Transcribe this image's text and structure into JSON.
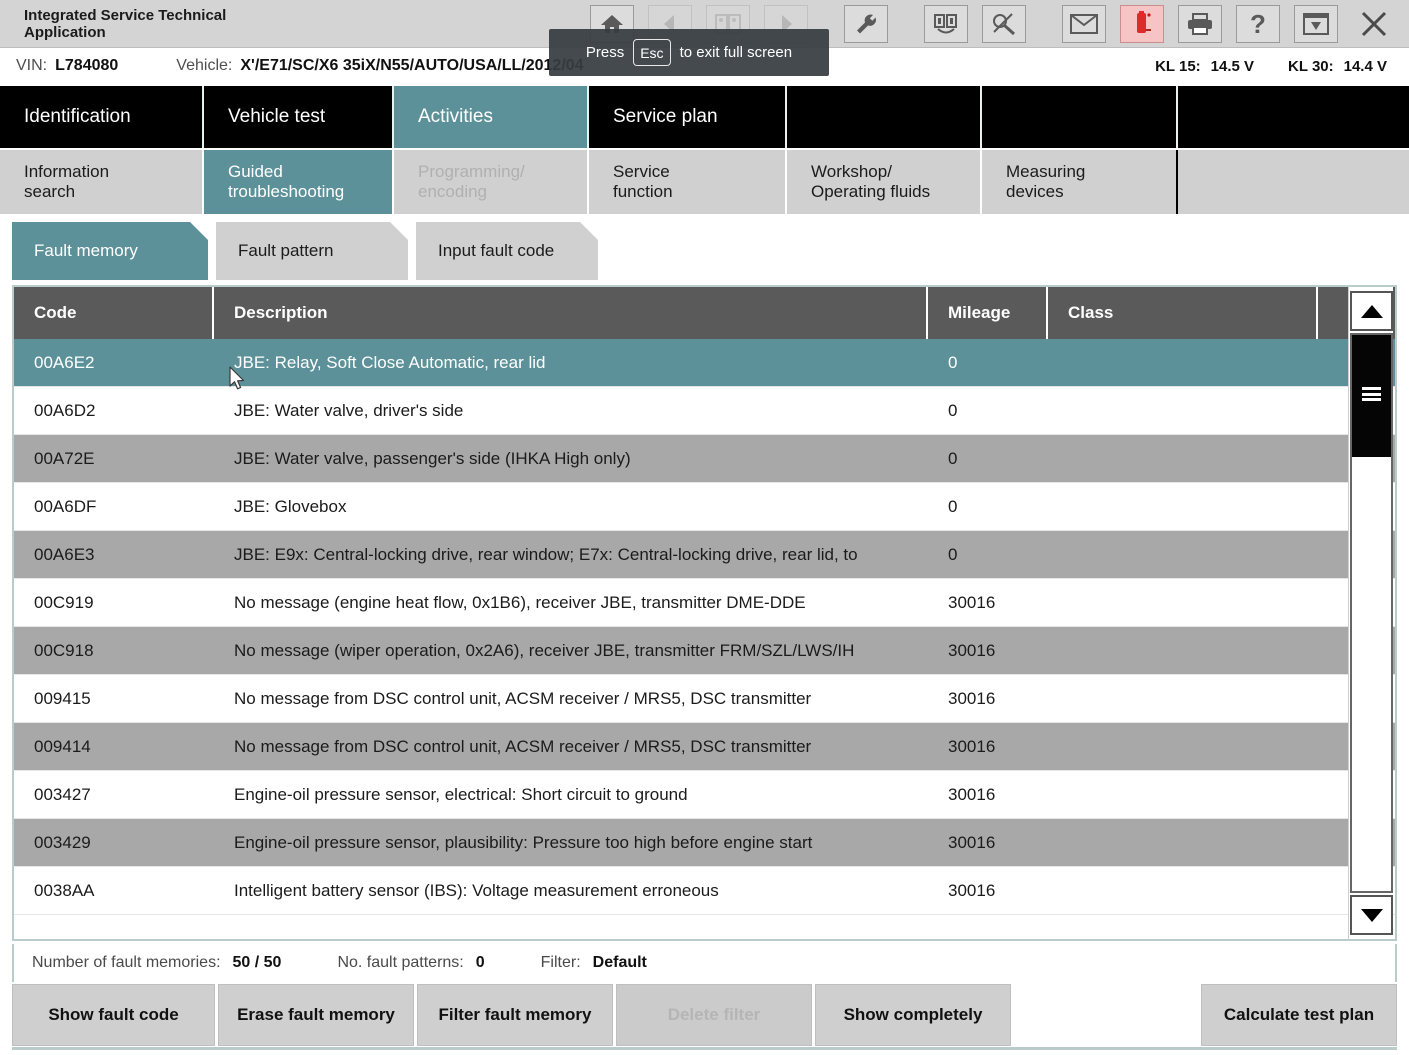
{
  "titlebar": {
    "app_title": "Integrated Service Technical\nApplication",
    "icons": [
      {
        "name": "home-icon",
        "label": "Home"
      },
      {
        "name": "back-arrow-icon",
        "label": "Back"
      },
      {
        "name": "documents-icon",
        "label": "Documents"
      },
      {
        "name": "forward-arrow-icon",
        "label": "Forward"
      },
      {
        "name": "wrench-icon",
        "label": "Tools"
      },
      {
        "name": "diagnostics-icon",
        "label": "Diagnostics"
      },
      {
        "name": "connector-icon",
        "label": "Connection"
      },
      {
        "name": "envelope-icon",
        "label": "Messages"
      },
      {
        "name": "battery-icon",
        "label": "Battery"
      },
      {
        "name": "printer-icon",
        "label": "Print"
      },
      {
        "name": "help-icon",
        "label": "Help"
      },
      {
        "name": "minimize-icon",
        "label": "Minimize"
      },
      {
        "name": "close-icon",
        "label": "Close"
      }
    ]
  },
  "vehicle_bar": {
    "vin_label": "VIN:",
    "vin_value": "L784080",
    "vehicle_label": "Vehicle:",
    "vehicle_value": "X'/E71/SC/X6 35iX/N55/AUTO/USA/LL/2012/04",
    "kl15_label": "KL 15:",
    "kl15_value": "14.5 V",
    "kl30_label": "KL 30:",
    "kl30_value": "14.4 V"
  },
  "main_nav": [
    {
      "label": "Identification",
      "active": false
    },
    {
      "label": "Vehicle test",
      "active": false
    },
    {
      "label": "Activities",
      "active": true
    },
    {
      "label": "Service plan",
      "active": false
    },
    {
      "label": "",
      "active": false
    },
    {
      "label": "",
      "active": false
    },
    {
      "label": "",
      "active": false
    }
  ],
  "sub_nav": [
    {
      "label": "Information\nsearch",
      "active": false,
      "disabled": false
    },
    {
      "label": "Guided\ntroubleshooting",
      "active": true,
      "disabled": false
    },
    {
      "label": "Programming/\nencoding",
      "active": false,
      "disabled": true
    },
    {
      "label": "Service\nfunction",
      "active": false,
      "disabled": false
    },
    {
      "label": "Workshop/\nOperating fluids",
      "active": false,
      "disabled": false
    },
    {
      "label": "Measuring\ndevices",
      "active": false,
      "disabled": false
    },
    {
      "label": "",
      "active": false,
      "disabled": false
    }
  ],
  "tabs": [
    {
      "label": "Fault memory",
      "active": true
    },
    {
      "label": "Fault pattern",
      "active": false
    },
    {
      "label": "Input fault code",
      "active": false
    }
  ],
  "table": {
    "columns": [
      "Code",
      "Description",
      "Mileage",
      "Class"
    ],
    "rows": [
      {
        "code": "00A6E2",
        "description": "JBE: Relay, Soft Close Automatic, rear lid",
        "mileage": "0",
        "class": "",
        "selected": true
      },
      {
        "code": "00A6D2",
        "description": "JBE: Water valve, driver's side",
        "mileage": "0",
        "class": "",
        "selected": false
      },
      {
        "code": "00A72E",
        "description": "JBE: Water valve, passenger's side (IHKA High only)",
        "mileage": "0",
        "class": "",
        "selected": false
      },
      {
        "code": "00A6DF",
        "description": "JBE: Glovebox",
        "mileage": "0",
        "class": "",
        "selected": false
      },
      {
        "code": "00A6E3",
        "description": "JBE: E9x: Central-locking drive, rear window; E7x: Central-locking drive, rear lid, to",
        "mileage": "0",
        "class": "",
        "selected": false
      },
      {
        "code": "00C919",
        "description": "No message (engine heat flow, 0x1B6), receiver JBE, transmitter DME-DDE",
        "mileage": "30016",
        "class": "",
        "selected": false
      },
      {
        "code": "00C918",
        "description": "No message (wiper operation, 0x2A6), receiver JBE, transmitter FRM/SZL/LWS/IH",
        "mileage": "30016",
        "class": "",
        "selected": false
      },
      {
        "code": "009415",
        "description": "No message from DSC control unit, ACSM receiver / MRS5, DSC transmitter",
        "mileage": "30016",
        "class": "",
        "selected": false
      },
      {
        "code": "009414",
        "description": "No message from DSC control unit, ACSM receiver / MRS5, DSC transmitter",
        "mileage": "30016",
        "class": "",
        "selected": false
      },
      {
        "code": "003427",
        "description": "Engine-oil pressure sensor, electrical: Short circuit to ground",
        "mileage": "30016",
        "class": "",
        "selected": false
      },
      {
        "code": "003429",
        "description": "Engine-oil pressure sensor, plausibility: Pressure too high before engine start",
        "mileage": "30016",
        "class": "",
        "selected": false
      },
      {
        "code": "0038AA",
        "description": "Intelligent battery sensor (IBS): Voltage measurement erroneous",
        "mileage": "30016",
        "class": "",
        "selected": false
      }
    ]
  },
  "status": {
    "count_label": "Number of fault memories:",
    "count_value": "50 / 50",
    "patterns_label": "No. fault patterns:",
    "patterns_value": "0",
    "filter_label": "Filter:",
    "filter_value": "Default"
  },
  "buttons": [
    {
      "label": "Show fault code",
      "disabled": false
    },
    {
      "label": "Erase fault memory",
      "disabled": false
    },
    {
      "label": "Filter fault memory",
      "disabled": false
    },
    {
      "label": "Delete filter",
      "disabled": true
    },
    {
      "label": "Show completely",
      "disabled": false
    },
    {
      "label": "Calculate test plan",
      "disabled": false
    }
  ],
  "tooltip": {
    "prefix": "Press",
    "key": "Esc",
    "suffix": "to exit full screen"
  },
  "colors": {
    "accent_teal": "#5c9199",
    "header_grey": "#5a5a5a",
    "row_alt": "#a8a8a8",
    "alert_red": "#d93b3b"
  }
}
